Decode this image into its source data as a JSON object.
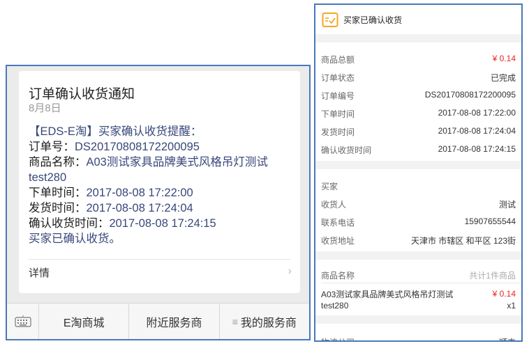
{
  "left": {
    "card": {
      "title": "订单确认收货通知",
      "date": "8月8日",
      "line1": "【EDS-E淘】买家确认收货提醒：",
      "order_label": "订单号：",
      "order_value": "DS20170808172200095",
      "product_label": "商品名称：",
      "product_value_1": "A03测试家具品牌美式风格吊灯测试",
      "product_value_2": "test280",
      "order_time_label": "下单时间：",
      "order_time_value": "2017-08-08 17:22:00",
      "ship_time_label": "发货时间：",
      "ship_time_value": "2017-08-08 17:24:04",
      "confirm_time_label": "确认收货时间：",
      "confirm_time_value": "2017-08-08 17:24:15",
      "closing": "买家已确认收货。",
      "detail_label": "详情",
      "detail_chevron": "›"
    },
    "menu": {
      "keyboard_icon": "keyboard-icon",
      "items": [
        {
          "label": "E淘商城"
        },
        {
          "label": "附近服务商"
        },
        {
          "label": "我的服务商",
          "prefix": "≡"
        }
      ]
    }
  },
  "right": {
    "header": {
      "title": "买家已确认收货",
      "icon": "receipt-check-icon",
      "icon_color": "#f5a623"
    },
    "summary": [
      {
        "key": "商品总额",
        "value": "¥ 0.14",
        "style": "red"
      },
      {
        "key": "订单状态",
        "value": "已完成"
      },
      {
        "key": "订单编号",
        "value": "DS20170808172200095"
      },
      {
        "key": "下单时间",
        "value": "2017-08-08 17:22:00"
      },
      {
        "key": "发货时间",
        "value": "2017-08-08 17:24:04"
      },
      {
        "key": "确认收货时间",
        "value": "2017-08-08 17:24:15"
      }
    ],
    "buyer": {
      "section_label": "买家",
      "rows": [
        {
          "key": "收货人",
          "value": "测试"
        },
        {
          "key": "联系电话",
          "value": "15907655544"
        },
        {
          "key": "收货地址",
          "value": "天津市 市辖区 和平区 123街"
        }
      ]
    },
    "goods": {
      "header_key": "商品名称",
      "header_value": "共计1件商品",
      "name_1": "A03测试家具品牌美式风格吊灯测试",
      "name_2": "test280",
      "price": "¥ 0.14",
      "qty": "x1"
    },
    "logistics": {
      "key": "物流公司",
      "value": "顺丰"
    }
  },
  "colors": {
    "accent_red": "#ee2222",
    "link_blue": "#38477a",
    "frame_blue": "#4a78b9"
  }
}
